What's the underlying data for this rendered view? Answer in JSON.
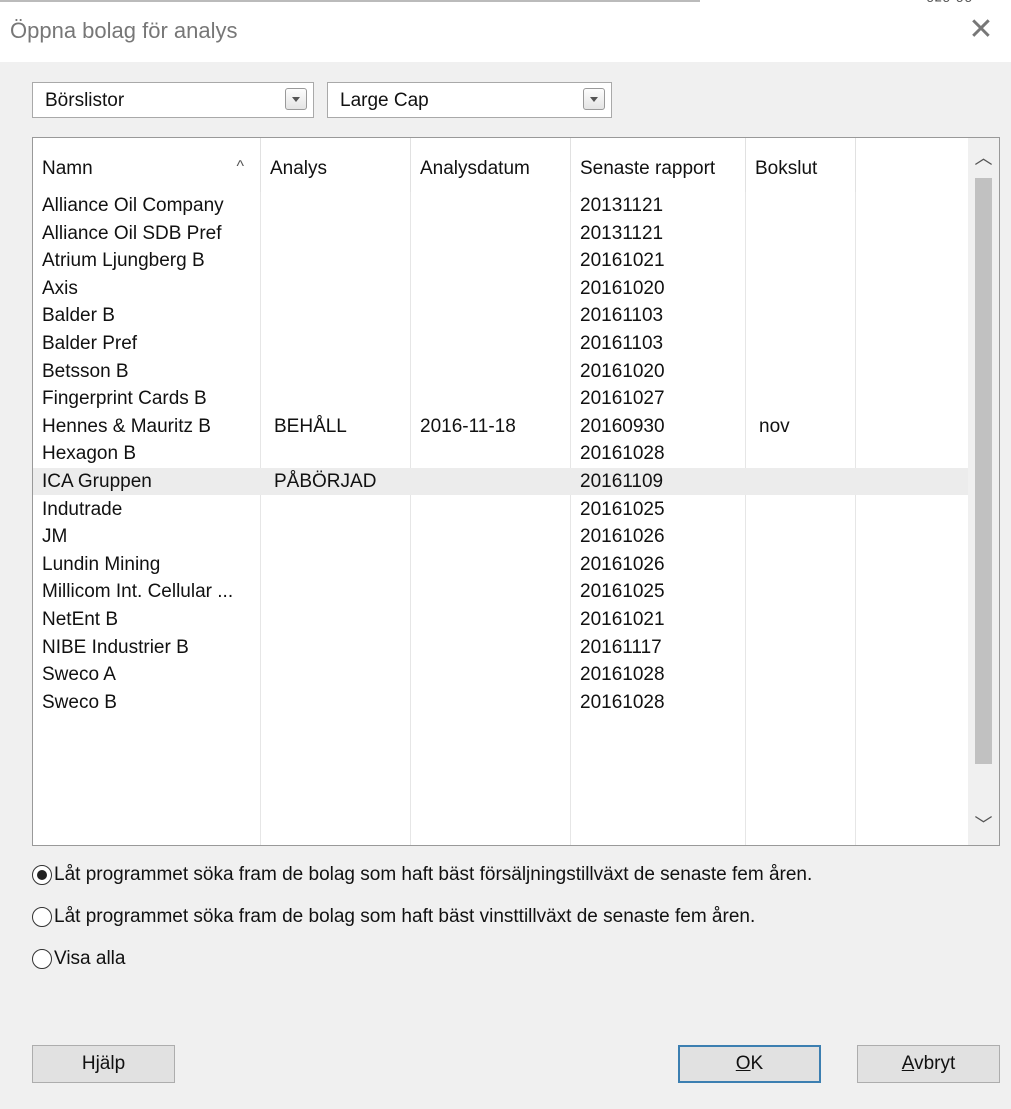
{
  "window": {
    "title": "Öppna bolag för analys",
    "close_glyph": "✕",
    "top_fragment": "ᵒ²ᵒ'ᵒᵒ"
  },
  "filters": {
    "list_type": "Börslistor",
    "list_value": "Large Cap"
  },
  "table": {
    "columns": [
      "Namn",
      "Analys",
      "Analysdatum",
      "Senaste rapport",
      "Bokslut"
    ],
    "sort_glyph": "^",
    "rows": [
      {
        "name": "Alliance Oil Company",
        "analys": "",
        "datum": "",
        "rapport": "20131121",
        "bokslut": ""
      },
      {
        "name": "Alliance Oil SDB Pref",
        "analys": "",
        "datum": "",
        "rapport": "20131121",
        "bokslut": ""
      },
      {
        "name": "Atrium Ljungberg B",
        "analys": "",
        "datum": "",
        "rapport": "20161021",
        "bokslut": ""
      },
      {
        "name": "Axis",
        "analys": "",
        "datum": "",
        "rapport": "20161020",
        "bokslut": ""
      },
      {
        "name": "Balder B",
        "analys": "",
        "datum": "",
        "rapport": "20161103",
        "bokslut": ""
      },
      {
        "name": "Balder Pref",
        "analys": "",
        "datum": "",
        "rapport": "20161103",
        "bokslut": ""
      },
      {
        "name": "Betsson B",
        "analys": "",
        "datum": "",
        "rapport": "20161020",
        "bokslut": ""
      },
      {
        "name": "Fingerprint Cards B",
        "analys": "",
        "datum": "",
        "rapport": "20161027",
        "bokslut": ""
      },
      {
        "name": "Hennes & Mauritz B",
        "analys": "BEHÅLL",
        "datum": "2016-11-18",
        "rapport": "20160930",
        "bokslut": "nov"
      },
      {
        "name": "Hexagon B",
        "analys": "",
        "datum": "",
        "rapport": "20161028",
        "bokslut": ""
      },
      {
        "name": "ICA Gruppen",
        "analys": "PÅBÖRJAD",
        "datum": "",
        "rapport": "20161109",
        "bokslut": ""
      },
      {
        "name": "Indutrade",
        "analys": "",
        "datum": "",
        "rapport": "20161025",
        "bokslut": ""
      },
      {
        "name": "JM",
        "analys": "",
        "datum": "",
        "rapport": "20161026",
        "bokslut": ""
      },
      {
        "name": "Lundin Mining",
        "analys": "",
        "datum": "",
        "rapport": "20161026",
        "bokslut": ""
      },
      {
        "name": "Millicom Int. Cellular ...",
        "analys": "",
        "datum": "",
        "rapport": "20161025",
        "bokslut": ""
      },
      {
        "name": "NetEnt B",
        "analys": "",
        "datum": "",
        "rapport": "20161021",
        "bokslut": ""
      },
      {
        "name": "NIBE Industrier B",
        "analys": "",
        "datum": "",
        "rapport": "20161117",
        "bokslut": ""
      },
      {
        "name": "Sweco A",
        "analys": "",
        "datum": "",
        "rapport": "20161028",
        "bokslut": ""
      },
      {
        "name": "Sweco B",
        "analys": "",
        "datum": "",
        "rapport": "20161028",
        "bokslut": ""
      }
    ],
    "selected_row": "ICA Gruppen"
  },
  "options": [
    {
      "label": "Låt programmet söka fram de bolag som haft bäst försäljningstillväxt de senaste fem åren.",
      "checked": true
    },
    {
      "label": "Låt programmet söka fram de bolag som haft bäst vinsttillväxt de senaste fem åren.",
      "checked": false
    },
    {
      "label": "Visa alla",
      "checked": false
    }
  ],
  "buttons": {
    "help": "Hjälp",
    "ok_first": "O",
    "ok_rest": "K",
    "cancel_first": "A",
    "cancel_rest": "vbryt"
  }
}
